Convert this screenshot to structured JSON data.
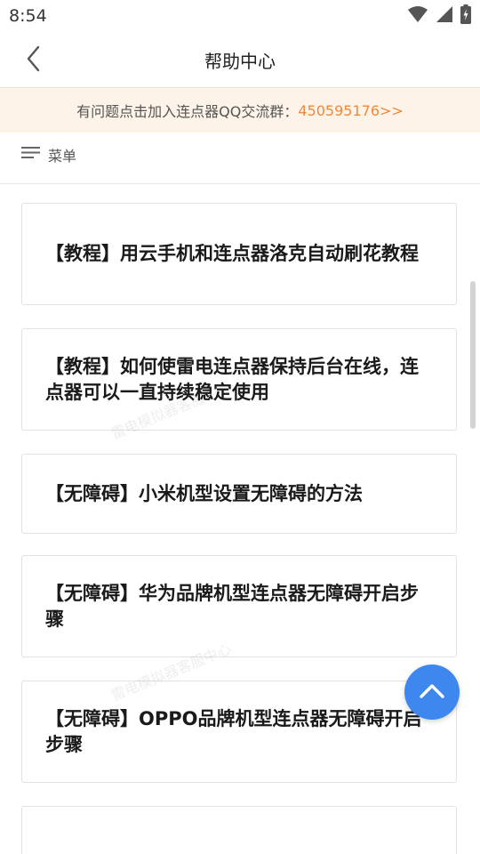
{
  "status_bar": {
    "time": "8:54",
    "icons": [
      "wifi-icon",
      "signal-icon",
      "battery-icon"
    ]
  },
  "header": {
    "title": "帮助中心",
    "back_icon": "chevron-left-icon"
  },
  "notice": {
    "text": "有问题点击加入连点器QQ交流群：",
    "link": "450595176>>",
    "link_color": "#f0883a",
    "background": "#fdf3e8"
  },
  "menu": {
    "label": "菜单",
    "icon": "menu-lines-icon"
  },
  "articles": [
    {
      "title": "【教程】用云手机和连点器洛克自动刷花教程"
    },
    {
      "title": "【教程】如何使雷电连点器保持后台在线，连点器可以一直持续稳定使用"
    },
    {
      "title": "【无障碍】小米机型设置无障碍的方法"
    },
    {
      "title": "【无障碍】华为品牌机型连点器无障碍开启步骤"
    },
    {
      "title": "【无障碍】OPPO品牌机型连点器无障碍开启步骤"
    }
  ],
  "watermark": "雷电模拟器客服中心",
  "fab": {
    "icon": "chevron-up-icon",
    "color": "#3d87ee"
  }
}
